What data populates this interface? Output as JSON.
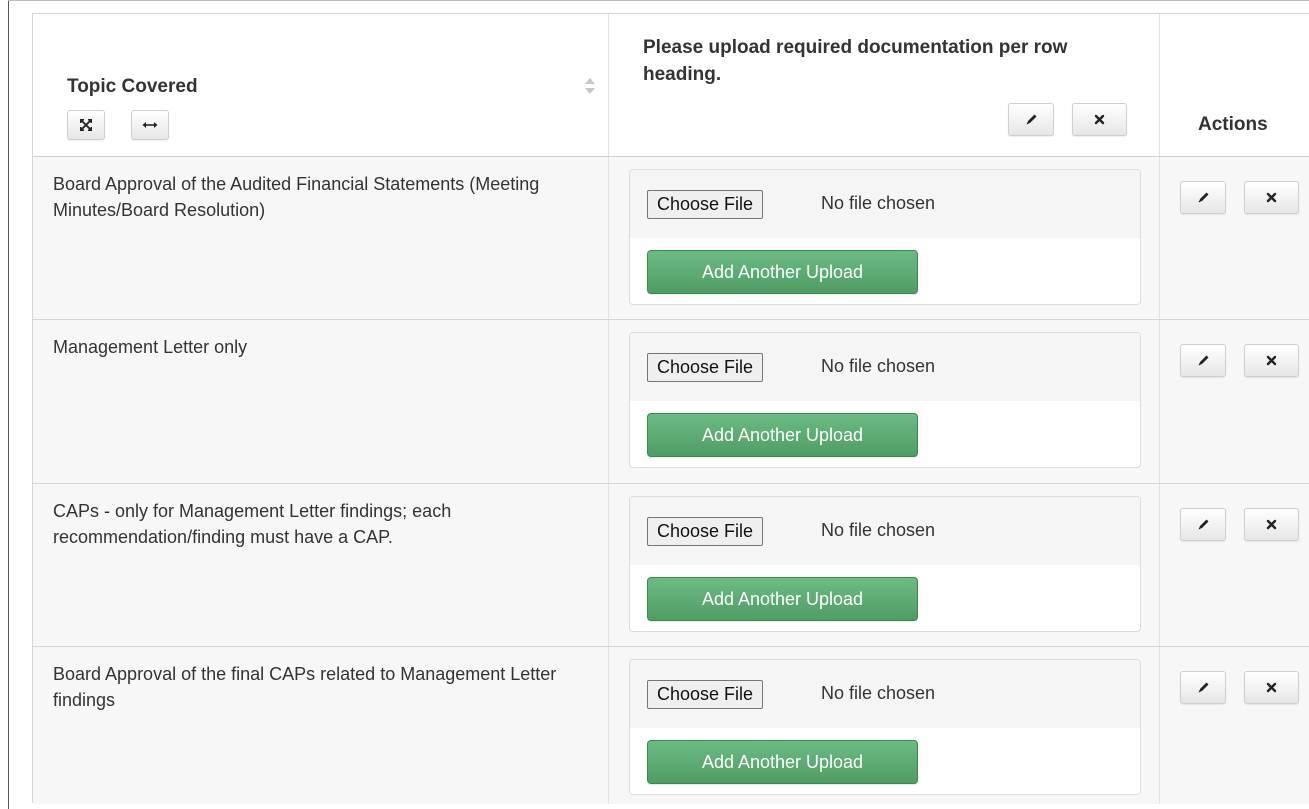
{
  "header": {
    "topic_title": "Topic Covered",
    "upload_title": "Please upload required documentation per row heading.",
    "actions_title": "Actions"
  },
  "icons": {
    "expand": "expand-icon",
    "resize_horizontal": "horizontal-arrow-icon",
    "edit": "pencil-icon",
    "delete": "close-icon",
    "sort": "sort-icon"
  },
  "upload": {
    "choose_label": "Choose File",
    "no_file": "No file chosen",
    "add_label": "Add Another Upload"
  },
  "rows": [
    {
      "topic": "Board Approval of the Audited Financial Statements (Meeting Minutes/Board Resolution)"
    },
    {
      "topic": "Management Letter only"
    },
    {
      "topic": "CAPs - only for Management Letter findings; each recommendation/finding must have a CAP."
    },
    {
      "topic": "Board Approval of the final CAPs related to Management Letter findings"
    }
  ],
  "colors": {
    "add_button": "#5cb075",
    "row_background": "#f7f7f7",
    "border": "#d6d6d6"
  }
}
